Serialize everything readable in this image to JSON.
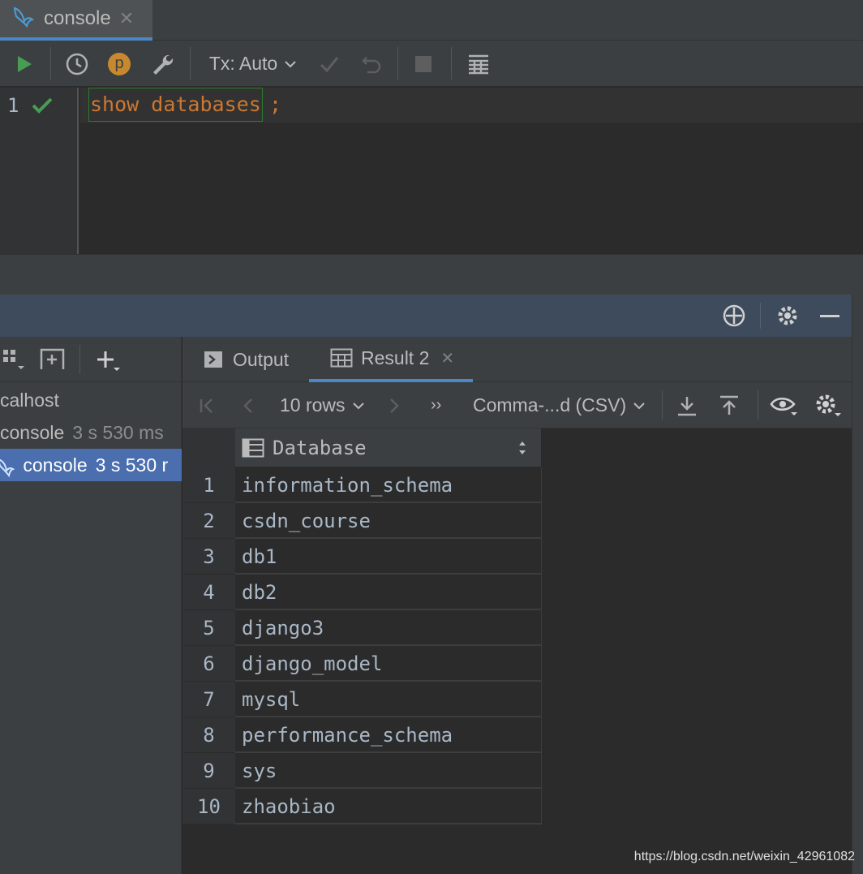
{
  "editor_tab": {
    "label": "console",
    "close": "✕"
  },
  "toolbar": {
    "tx_label": "Tx: Auto",
    "p_badge": "p"
  },
  "editor": {
    "line_number": "1",
    "keyword_show": "show",
    "keyword_databases": "databases",
    "terminator": ";"
  },
  "services": {
    "tree": [
      {
        "label": "calhost",
        "duration": ""
      },
      {
        "label": "console",
        "duration": "3 s 530 ms"
      },
      {
        "label": "console",
        "duration": "3 s 530 r"
      }
    ]
  },
  "result_tabs": {
    "output": "Output",
    "result": "Result 2",
    "close": "✕"
  },
  "result_toolbar": {
    "rows": "10 rows",
    "more": "››",
    "export_format": "Comma-...d (CSV)"
  },
  "grid": {
    "column": "Database",
    "rows": [
      {
        "n": "1",
        "v": "information_schema"
      },
      {
        "n": "2",
        "v": "csdn_course"
      },
      {
        "n": "3",
        "v": "db1"
      },
      {
        "n": "4",
        "v": "db2"
      },
      {
        "n": "5",
        "v": "django3"
      },
      {
        "n": "6",
        "v": "django_model"
      },
      {
        "n": "7",
        "v": "mysql"
      },
      {
        "n": "8",
        "v": "performance_schema"
      },
      {
        "n": "9",
        "v": "sys"
      },
      {
        "n": "10",
        "v": "zhaobiao"
      }
    ]
  },
  "watermark": "https://blog.csdn.net/weixin_42961082",
  "colors": {
    "accent": "#4a88c7",
    "selection": "#4b6eaf",
    "run_green": "#499c54",
    "keyword": "#cc7832"
  }
}
